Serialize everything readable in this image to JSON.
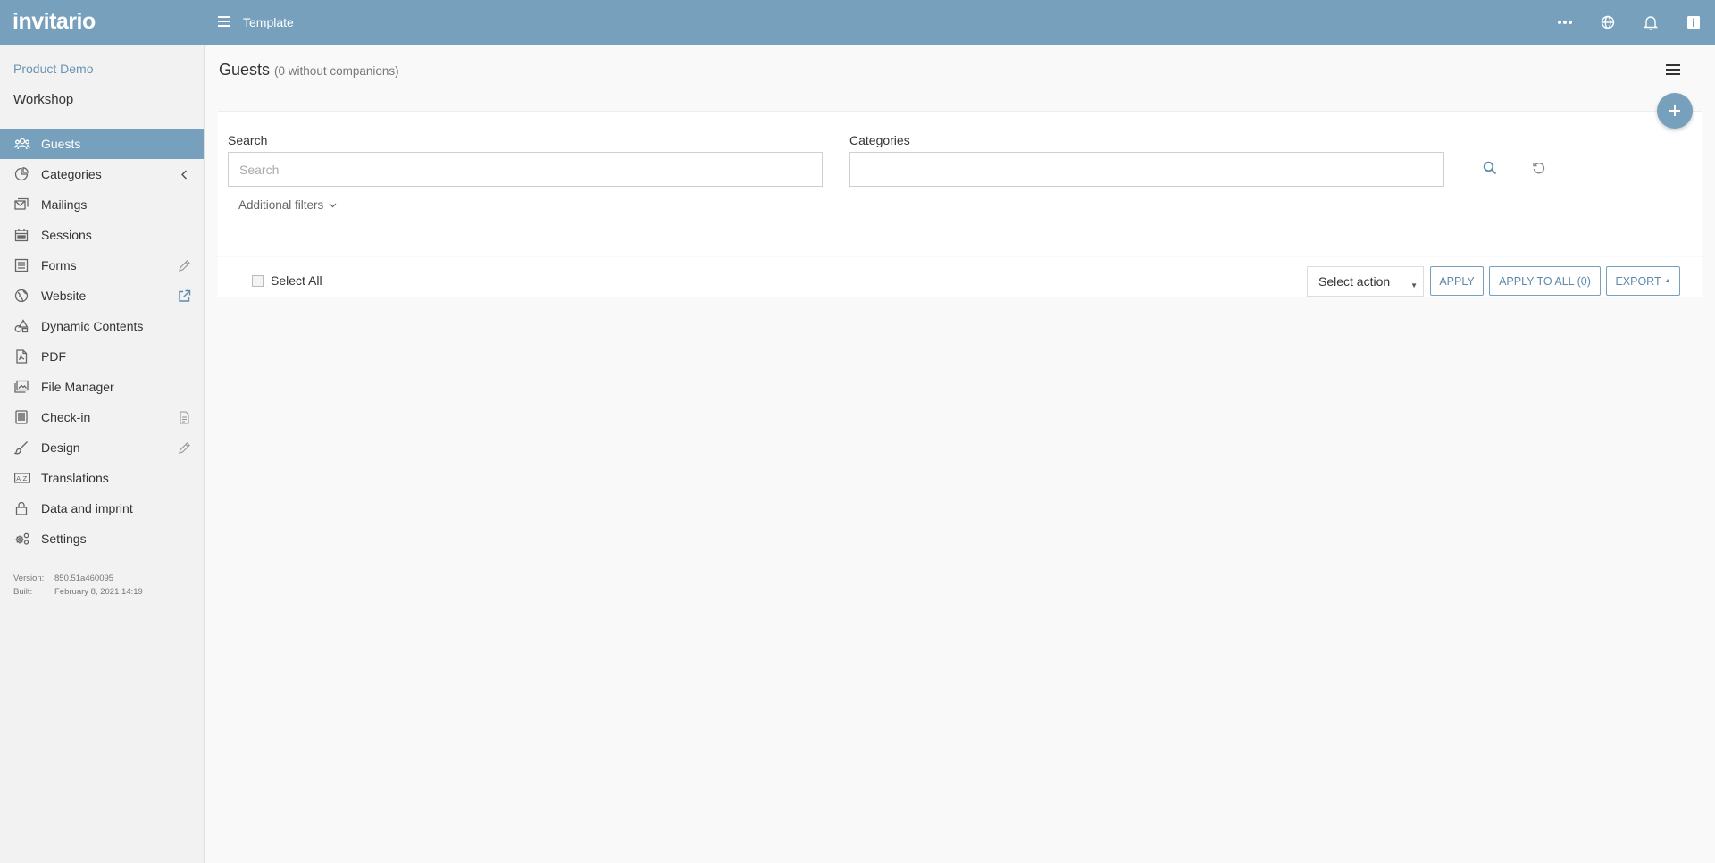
{
  "app": {
    "logo": "invitario",
    "template_title": "Template"
  },
  "topbar": {
    "icons": [
      "more-dots-icon",
      "globe-icon",
      "bell-icon",
      "info-icon"
    ]
  },
  "sidebar": {
    "project": "Product Demo",
    "event": "Workshop",
    "items": [
      {
        "label": "Guests",
        "icon": "guests-icon",
        "active": true
      },
      {
        "label": "Categories",
        "icon": "categories-icon",
        "right_icon": "chevron-left-icon"
      },
      {
        "label": "Mailings",
        "icon": "mailings-icon"
      },
      {
        "label": "Sessions",
        "icon": "calendar-icon"
      },
      {
        "label": "Forms",
        "icon": "forms-icon",
        "right_icon": "pencil-icon"
      },
      {
        "label": "Website",
        "icon": "globe-icon",
        "right_icon": "external-link-icon"
      },
      {
        "label": "Dynamic Contents",
        "icon": "shapes-icon"
      },
      {
        "label": "PDF",
        "icon": "pdf-icon"
      },
      {
        "label": "File Manager",
        "icon": "images-icon"
      },
      {
        "label": "Check-in",
        "icon": "tablet-icon",
        "right_icon": "document-icon"
      },
      {
        "label": "Design",
        "icon": "brush-icon",
        "right_icon": "pencil-icon"
      },
      {
        "label": "Translations",
        "icon": "translate-icon"
      },
      {
        "label": "Data and imprint",
        "icon": "lock-icon"
      },
      {
        "label": "Settings",
        "icon": "gears-icon"
      }
    ],
    "version_label": "Version:",
    "version": "850.51a460095",
    "built_label": "Built:",
    "built": "February 8, 2021 14:19"
  },
  "main": {
    "title": "Guests",
    "subtitle": "(0 without companions)",
    "search": {
      "label": "Search",
      "placeholder": "Search",
      "value": ""
    },
    "categories": {
      "label": "Categories",
      "value": ""
    },
    "additional_filters": "Additional filters",
    "select_all": "Select All",
    "select_action": "Select action",
    "apply": "APPLY",
    "apply_all": "APPLY TO ALL (0)",
    "export": "EXPORT"
  },
  "colors": {
    "accent": "#77a0bc",
    "link": "#6a94b2",
    "button_text": "#5d89aa"
  }
}
